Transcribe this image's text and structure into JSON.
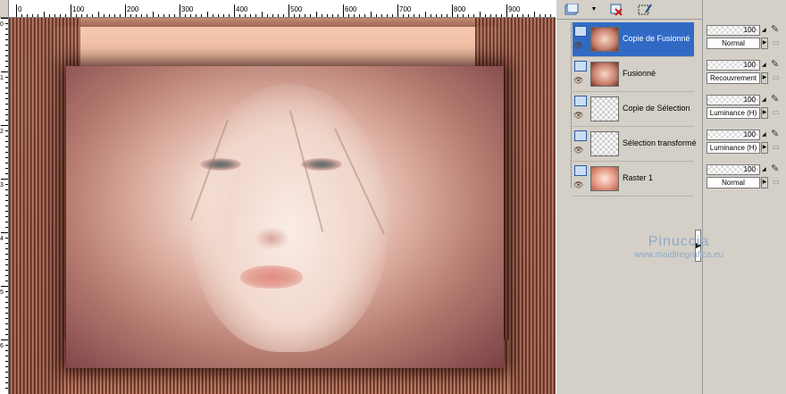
{
  "ruler": {
    "top_labels": [
      "0",
      "100",
      "200",
      "300",
      "400",
      "500",
      "600",
      "700",
      "800",
      "900"
    ],
    "left_labels": [
      "0",
      "1",
      "2",
      "3",
      "4",
      "5",
      "6"
    ]
  },
  "toolbar": {
    "icons": [
      "layer-new-icon",
      "dropdown-arrow-icon",
      "delete-layer-icon",
      "edit-selection-icon"
    ]
  },
  "layers": [
    {
      "name": "Copie de Fusionné",
      "selected": true,
      "thumb": "face",
      "opacity": "100",
      "blend": "Normal"
    },
    {
      "name": "Fusionné",
      "selected": false,
      "thumb": "face",
      "opacity": "100",
      "blend": "Recouvrement"
    },
    {
      "name": "Copie de Sélection",
      "selected": false,
      "thumb": "checker",
      "opacity": "100",
      "blend": "Luminance (H)"
    },
    {
      "name": "Sélection transformée",
      "selected": false,
      "thumb": "checker",
      "opacity": "100",
      "blend": "Luminance (H)"
    },
    {
      "name": "Raster 1",
      "selected": false,
      "thumb": "raster",
      "opacity": "100",
      "blend": "Normal"
    }
  ],
  "watermark": {
    "title": "Pinuccia",
    "url": "www.maidiregrafica.eu"
  }
}
